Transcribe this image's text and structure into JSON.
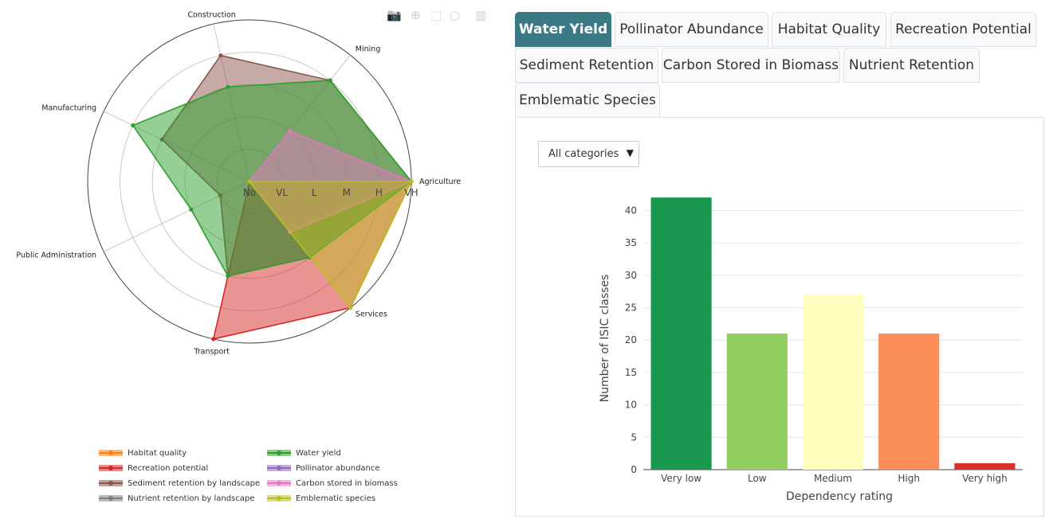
{
  "radar": {
    "type": "radar",
    "axes": [
      "Agriculture",
      "Mining",
      "Construction",
      "Manufacturing",
      "Public Administration",
      "Transport",
      "Services"
    ],
    "rating_levels": [
      "No",
      "VL",
      "L",
      "M",
      "H",
      "VH"
    ],
    "series": [
      {
        "name": "Habitat quality",
        "color": "#ff7f0e",
        "values": [
          5,
          0,
          0,
          0,
          0,
          0,
          0
        ]
      },
      {
        "name": "Recreation potential",
        "color": "#d62728",
        "values": [
          5,
          0,
          0,
          0,
          0,
          5,
          5
        ]
      },
      {
        "name": "Sediment retention by landscape",
        "color": "#8c564b",
        "values": [
          5,
          4,
          4,
          3,
          1,
          3,
          3
        ]
      },
      {
        "name": "Nutrient retention by landscape",
        "color": "#7f7f7f",
        "values": [
          5,
          0,
          0,
          0,
          0,
          0,
          0
        ]
      },
      {
        "name": "Water yield",
        "color": "#2ca02c",
        "values": [
          5,
          4,
          3,
          4,
          2,
          3,
          3
        ]
      },
      {
        "name": "Pollinator abundance",
        "color": "#9467bd",
        "values": [
          0,
          0,
          0,
          0,
          0,
          0,
          0
        ]
      },
      {
        "name": "Carbon stored in biomass",
        "color": "#e377c2",
        "values": [
          5,
          2,
          0,
          0,
          0,
          0,
          2
        ]
      },
      {
        "name": "Emblematic species",
        "color": "#bcbd22",
        "values": [
          5,
          0,
          0,
          0,
          0,
          0,
          5
        ]
      }
    ]
  },
  "tabs": [
    {
      "label": "Water Yield",
      "active": true
    },
    {
      "label": "Pollinator Abundance",
      "active": false
    },
    {
      "label": "Habitat Quality",
      "active": false
    },
    {
      "label": "Recreation Potential",
      "active": false
    },
    {
      "label": "Sediment Retention",
      "active": false
    },
    {
      "label": "Carbon Stored in Biomass",
      "active": false
    },
    {
      "label": "Nutrient Retention",
      "active": false
    },
    {
      "label": "Emblematic Species",
      "active": false
    }
  ],
  "dropdown": {
    "selected": "All categories"
  },
  "chart_data": {
    "type": "bar",
    "categories": [
      "Very low",
      "Low",
      "Medium",
      "High",
      "Very high"
    ],
    "values": [
      42,
      21,
      27,
      21,
      1
    ],
    "colors": [
      "#1a9850",
      "#91cf60",
      "#ffffbf",
      "#fc8d59",
      "#d73027"
    ],
    "xlabel": "Dependency rating",
    "ylabel": "Number of ISIC classes",
    "ylim": [
      0,
      43
    ],
    "yticks": [
      0,
      5,
      10,
      15,
      20,
      25,
      30,
      35,
      40
    ],
    "grid": true
  }
}
